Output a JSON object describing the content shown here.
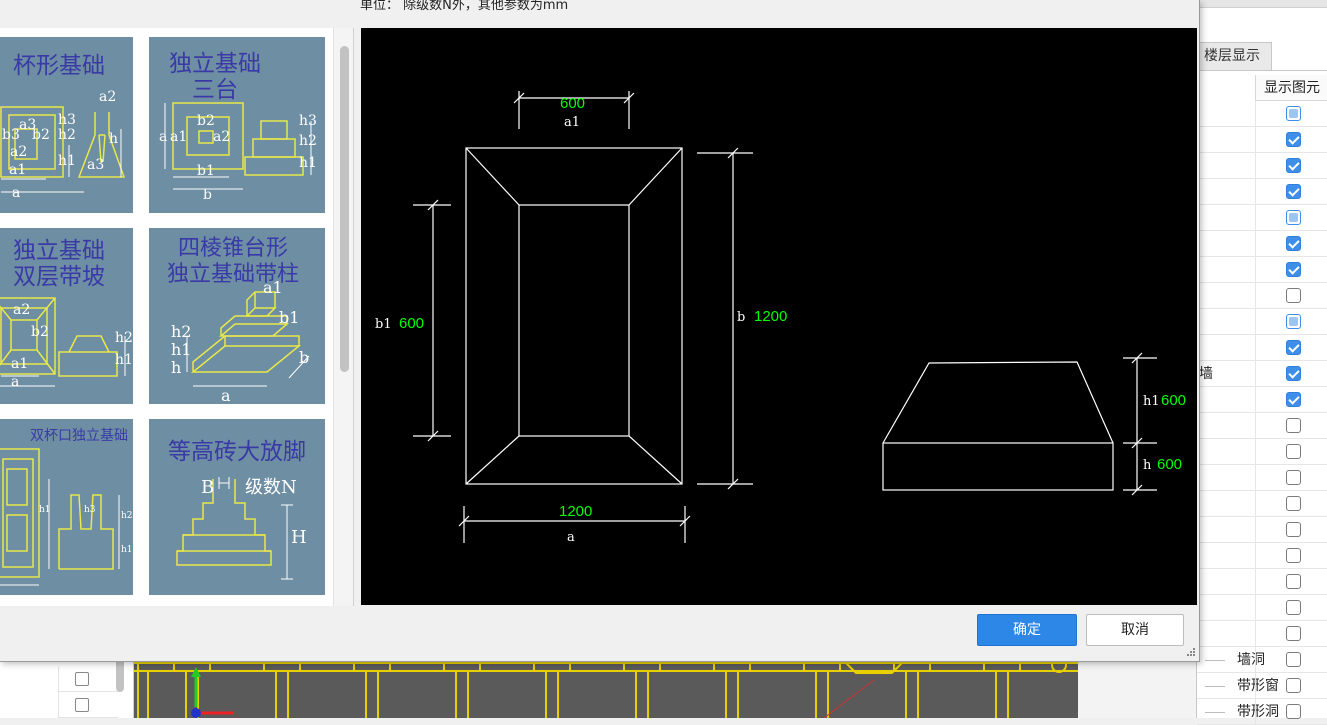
{
  "dialog": {
    "units_label": "单位：  除级数N外，其他参数为mm",
    "ok_label": "确定",
    "cancel_label": "取消"
  },
  "thumbnails": [
    {
      "title": "杯形基础",
      "dims": [
        "a2",
        "h3",
        "a3",
        "b3",
        "b2",
        "h2",
        "h",
        "a2",
        "h1",
        "a1",
        "a3",
        "a"
      ]
    },
    {
      "title": "独立基础\n三台",
      "dims": [
        "b2",
        "a1",
        "a2",
        "h3",
        "a",
        "h2",
        "b1",
        "h1",
        "b"
      ]
    },
    {
      "title": "独立基础\n双层带坡",
      "dims": [
        "a2",
        "b2",
        "h2",
        "a1",
        "h1",
        "a"
      ]
    },
    {
      "title": "四棱锥台形\n独立基础带柱",
      "dims": [
        "a1",
        "b1",
        "h2",
        "h1",
        "h",
        "b",
        "a"
      ]
    },
    {
      "title": "双杯口独立基础",
      "dims": [
        "h3",
        "h1",
        "h2",
        "h1"
      ]
    },
    {
      "title": "等高砖大放脚",
      "dims": [
        "B",
        "级数N",
        "H"
      ]
    }
  ],
  "preview": {
    "plan": {
      "a1_label": "a1",
      "a1_value": "600",
      "a_label": "a",
      "a_value": "1200",
      "b1_label": "b1",
      "b1_value": "600",
      "b_label": "b",
      "b_value": "1200"
    },
    "section": {
      "h1_label": "h1",
      "h1_value": "600",
      "h_label": "h",
      "h_value": "600"
    }
  },
  "right_panel": {
    "tab_label": "楼层显示",
    "column_header": "显示图元",
    "rows": [
      {
        "label": "",
        "state": "partial"
      },
      {
        "label": "",
        "state": "checked"
      },
      {
        "label": "",
        "state": "checked"
      },
      {
        "label": "",
        "state": "checked"
      },
      {
        "label": "",
        "state": "partial"
      },
      {
        "label": "",
        "state": "checked"
      },
      {
        "label": "",
        "state": "checked"
      },
      {
        "label": "",
        "state": "unchecked"
      },
      {
        "label": "",
        "state": "partial"
      },
      {
        "label": "",
        "state": "checked"
      },
      {
        "label": "墙",
        "state": "checked"
      },
      {
        "label": "",
        "state": "checked"
      },
      {
        "label": "",
        "state": "unchecked"
      },
      {
        "label": "",
        "state": "unchecked"
      },
      {
        "label": "",
        "state": "unchecked"
      },
      {
        "label": "",
        "state": "unchecked"
      },
      {
        "label": "",
        "state": "unchecked"
      },
      {
        "label": "",
        "state": "unchecked"
      },
      {
        "label": "",
        "state": "unchecked"
      },
      {
        "label": "",
        "state": "unchecked"
      },
      {
        "label": "",
        "state": "unchecked"
      },
      {
        "label": "墙洞",
        "state": "unchecked"
      },
      {
        "label": "带形窗",
        "state": "unchecked"
      },
      {
        "label": "带形洞",
        "state": "unchecked"
      }
    ]
  },
  "colors": {
    "accent": "#2d87e6",
    "thumb_bg": "#6d8ea3",
    "thumb_line": "#e8e84a",
    "dim_value": "#00ff00",
    "canvas_yellow": "#e8d000"
  }
}
